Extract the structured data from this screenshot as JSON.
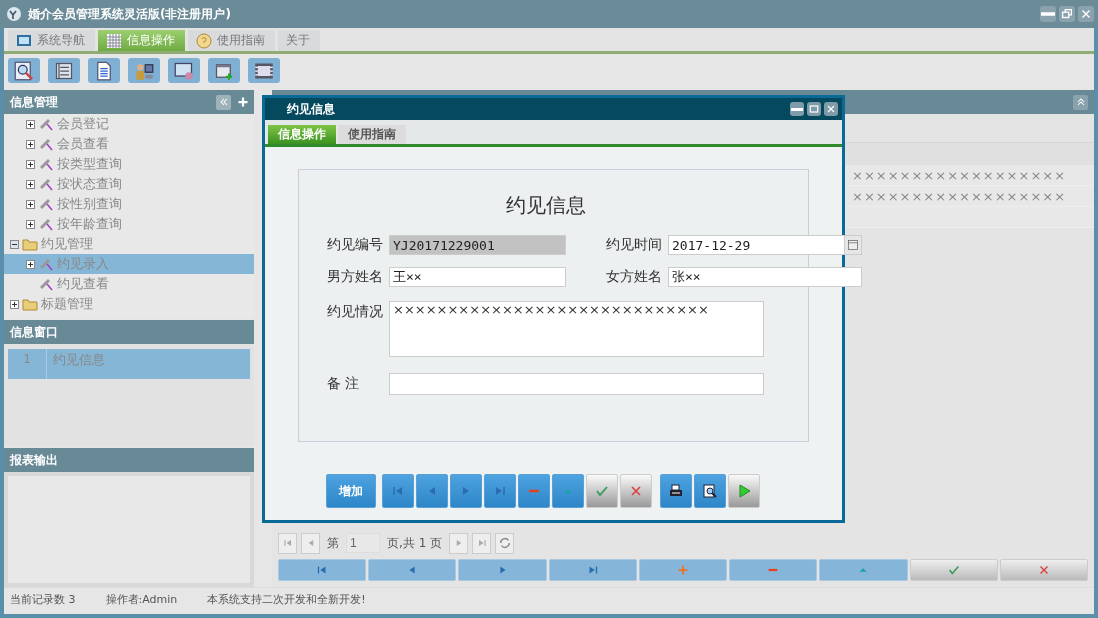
{
  "window": {
    "title": "婚介会员管理系统灵活版(非注册用户)"
  },
  "tabs": [
    {
      "label": "系统导航",
      "selected": false
    },
    {
      "label": "信息操作",
      "selected": true
    },
    {
      "label": "使用指南",
      "selected": false
    },
    {
      "label": "关于",
      "selected": false
    }
  ],
  "sidebar": {
    "title": "信息管理",
    "partial_children": [
      {
        "label": "会员登记",
        "kind": "page",
        "expanded": false,
        "selected": false
      },
      {
        "label": "会员查看",
        "kind": "page",
        "expanded": false,
        "selected": false
      },
      {
        "label": "按类型查询",
        "kind": "page",
        "expanded": false,
        "selected": false
      },
      {
        "label": "按状态查询",
        "kind": "page",
        "expanded": false,
        "selected": false
      },
      {
        "label": "按性别查询",
        "kind": "page",
        "expanded": false,
        "selected": false
      },
      {
        "label": "按年龄查询",
        "kind": "page",
        "expanded": false,
        "selected": false
      }
    ],
    "items": [
      {
        "label": "约见管理",
        "kind": "folder",
        "expanded": true,
        "selected": false,
        "children": [
          {
            "label": "约见录入",
            "kind": "page",
            "expanded": false,
            "selected": true
          },
          {
            "label": "约见查看",
            "kind": "page",
            "selected": false
          }
        ]
      },
      {
        "label": "标题管理",
        "kind": "folder",
        "expanded": false,
        "selected": false
      }
    ]
  },
  "window_list": {
    "title": "信息窗口",
    "rows": [
      {
        "index": "1",
        "label": "约见信息",
        "selected": true
      }
    ]
  },
  "report": {
    "title": "报表输出"
  },
  "grid": {
    "rows": [
      {
        "cell": "××××××××××××××××××"
      },
      {
        "cell": "××××××××××××××××××"
      }
    ]
  },
  "pager": {
    "page_label": "第",
    "page": "1",
    "total": "页,共 1 页"
  },
  "bottom_buttons": [
    {
      "disabled": false
    },
    {
      "disabled": false
    },
    {
      "disabled": false
    },
    {
      "disabled": false
    },
    {
      "disabled": false
    },
    {
      "disabled": false
    },
    {
      "disabled": false
    },
    {
      "disabled": true
    },
    {
      "disabled": true
    }
  ],
  "status_bar": [
    "当前记录数 3",
    "操作者:Admin",
    "本系统支持二次开发和全新开发!"
  ],
  "dialog": {
    "title": "约见信息",
    "tabs": [
      {
        "label": "信息操作",
        "selected": true
      },
      {
        "label": "使用指南",
        "selected": false
      }
    ],
    "heading": "约见信息",
    "fields": [
      {
        "label": "约见编号",
        "value": "YJ20171229001",
        "disabled": true
      },
      {
        "label": "约见时间",
        "value": "2017-12-29",
        "disabled": false,
        "kind": "date"
      },
      {
        "label": "男方姓名",
        "value": "王××",
        "disabled": false
      },
      {
        "label": "女方姓名",
        "value": "张××",
        "disabled": false
      }
    ],
    "notes": {
      "label": "约见情况",
      "value": "×××××××××××××××××××××××××××××"
    },
    "remark": {
      "label": "备 注"
    },
    "buttons": [
      {
        "label": "增加",
        "disabled": false
      },
      {
        "disabled": false
      },
      {
        "disabled": false
      },
      {
        "disabled": false
      },
      {
        "disabled": false
      },
      {
        "disabled": false
      },
      {
        "disabled": false
      },
      {
        "disabled": true
      },
      {
        "disabled": true
      },
      {
        "disabled": false
      },
      {
        "disabled": false
      },
      {
        "disabled": true
      }
    ]
  }
}
